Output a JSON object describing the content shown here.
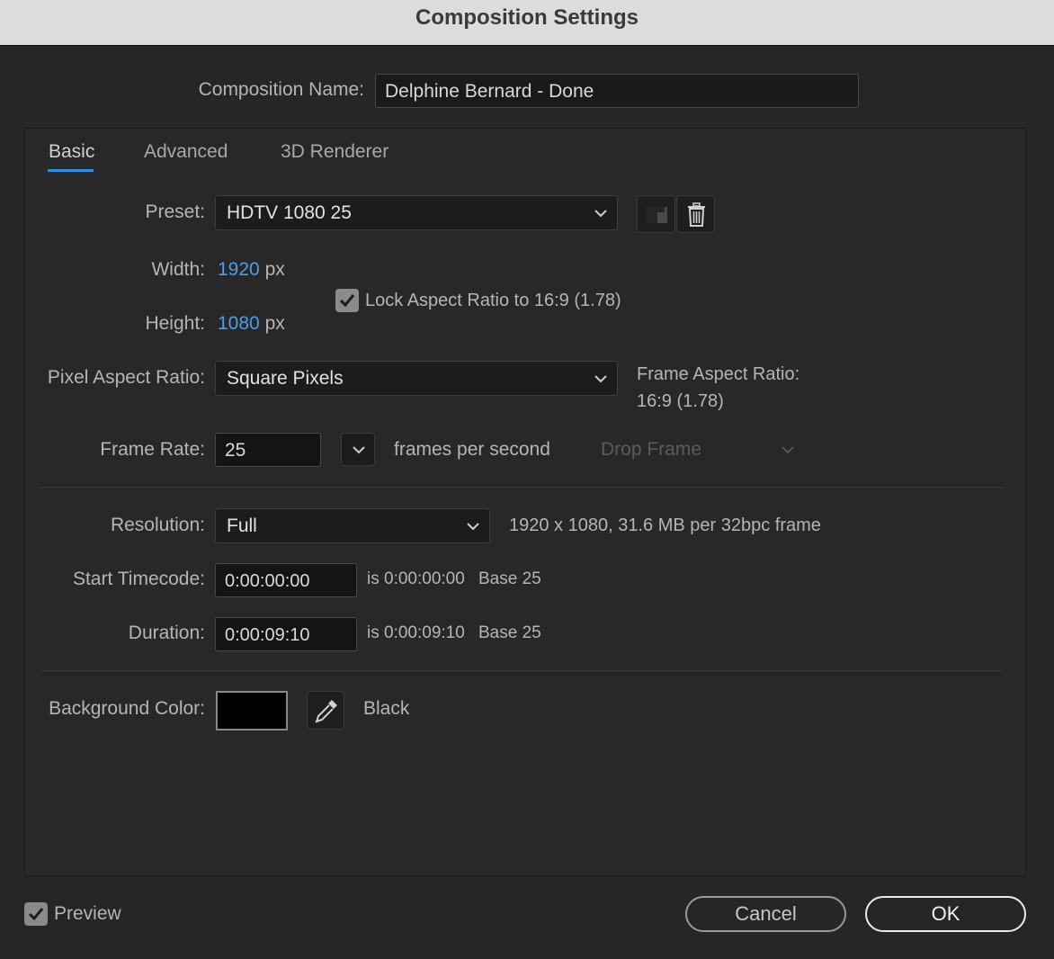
{
  "window": {
    "title": "Composition Settings"
  },
  "composition_name": {
    "label": "Composition Name:",
    "value": "Delphine Bernard - Done"
  },
  "tabs": [
    {
      "label": "Basic",
      "active": true
    },
    {
      "label": "Advanced",
      "active": false
    },
    {
      "label": "3D Renderer",
      "active": false
    }
  ],
  "preset": {
    "label": "Preset:",
    "value": "HDTV 1080 25"
  },
  "width": {
    "label": "Width:",
    "value": "1920",
    "unit": "px"
  },
  "height": {
    "label": "Height:",
    "value": "1080",
    "unit": "px"
  },
  "lock_aspect": {
    "label": "Lock Aspect Ratio to 16:9 (1.78)",
    "checked": true
  },
  "pixel_aspect": {
    "label": "Pixel Aspect Ratio:",
    "value": "Square Pixels"
  },
  "frame_aspect": {
    "label": "Frame Aspect Ratio:",
    "value": "16:9 (1.78)"
  },
  "frame_rate": {
    "label": "Frame Rate:",
    "value": "25",
    "unit_text": "frames per second",
    "drop_frame": "Drop Frame"
  },
  "resolution": {
    "label": "Resolution:",
    "value": "Full",
    "info": "1920 x 1080, 31.6 MB per 32bpc frame"
  },
  "start_timecode": {
    "label": "Start Timecode:",
    "value": "0:00:00:00",
    "is_text": "is 0:00:00:00",
    "base": "Base 25"
  },
  "duration": {
    "label": "Duration:",
    "value": "0:00:09:10",
    "is_text": "is 0:00:09:10",
    "base": "Base 25"
  },
  "background": {
    "label": "Background Color:",
    "color_name": "Black",
    "swatch": "#000000"
  },
  "footer": {
    "preview_label": "Preview",
    "preview_checked": true,
    "cancel_label": "Cancel",
    "ok_label": "OK"
  },
  "colors": {
    "accent": "#2d8ceb",
    "value_blue": "#4b9ee8"
  }
}
